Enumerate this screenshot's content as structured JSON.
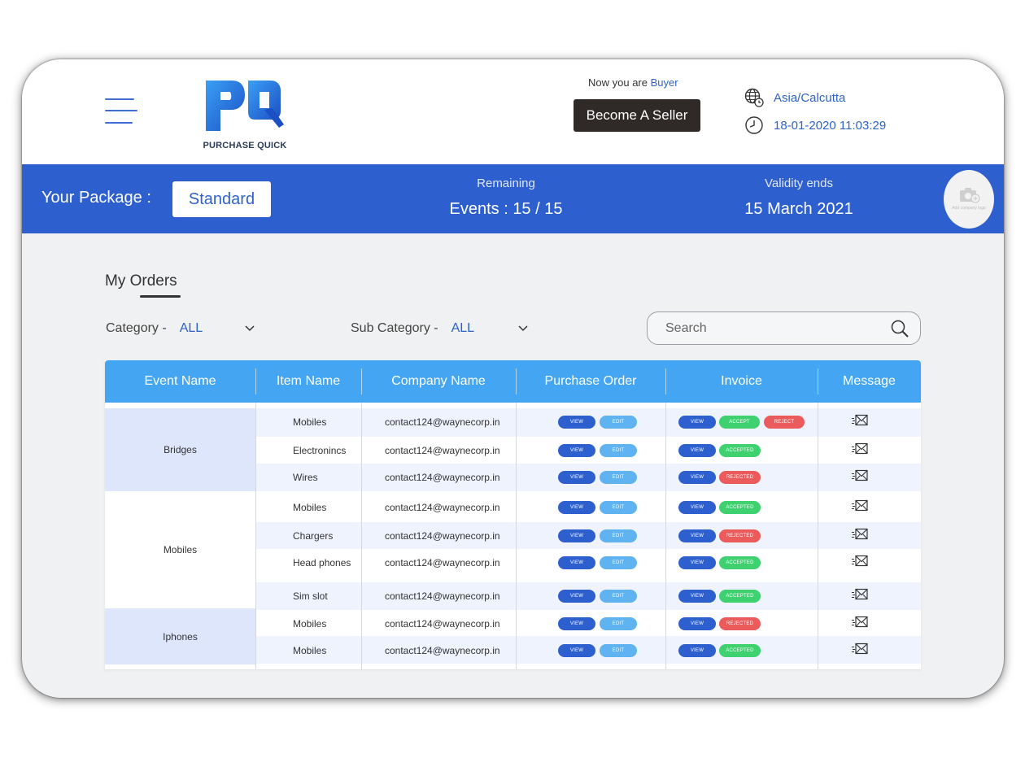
{
  "header": {
    "logo_text": "PURCHASE QUICK",
    "now_prefix": "Now you are",
    "role": "Buyer",
    "become_seller": "Become A Seller",
    "timezone": "Asia/Calcutta",
    "datetime": "18-01-2020 11:03:29"
  },
  "package": {
    "label": "Your Package :",
    "name": "Standard",
    "remaining_label": "Remaining",
    "remaining_value": "Events : 15 / 15",
    "validity_label": "Validity ends",
    "validity_value": "15 March 2021",
    "logo_upload_caption": "Add company logo"
  },
  "orders": {
    "title": "My Orders",
    "category_label": "Category -",
    "category_value": "ALL",
    "subcategory_label": "Sub Category -",
    "subcategory_value": "ALL",
    "search_placeholder": "Search",
    "columns": [
      "Event Name",
      "Item Name",
      "Company Name",
      "Purchase Order",
      "Invoice",
      "Message"
    ],
    "view_label": "VIEW",
    "edit_label": "EDIT",
    "accept_label": "ACCEPT",
    "reject_label": "REJECT",
    "accepted_label": "ACCEPTED",
    "rejected_label": "REJECTED",
    "groups": [
      {
        "event": "Bridges",
        "rows": [
          {
            "item": "Mobiles",
            "company": "contact124@waynecorp.in",
            "status": "pending"
          },
          {
            "item": "Electronincs",
            "company": "contact124@waynecorp.in",
            "status": "accepted"
          },
          {
            "item": "Wires",
            "company": "contact124@waynecorp.in",
            "status": "rejected"
          }
        ]
      },
      {
        "event": "Mobiles",
        "rows": [
          {
            "item": "Mobiles",
            "company": "contact124@waynecorp.in",
            "status": "accepted"
          },
          {
            "item": "Chargers",
            "company": "contact124@waynecorp.in",
            "status": "rejected"
          },
          {
            "item": "Head phones",
            "company": "contact124@waynecorp.in",
            "status": "accepted"
          },
          {
            "item": "Sim  slot",
            "company": "contact124@waynecorp.in",
            "status": "accepted"
          }
        ]
      },
      {
        "event": "Iphones",
        "rows": [
          {
            "item": "Mobiles",
            "company": "contact124@waynecorp.in",
            "status": "rejected"
          },
          {
            "item": "Mobiles",
            "company": "contact124@waynecorp.in",
            "status": "accepted"
          }
        ]
      }
    ]
  }
}
